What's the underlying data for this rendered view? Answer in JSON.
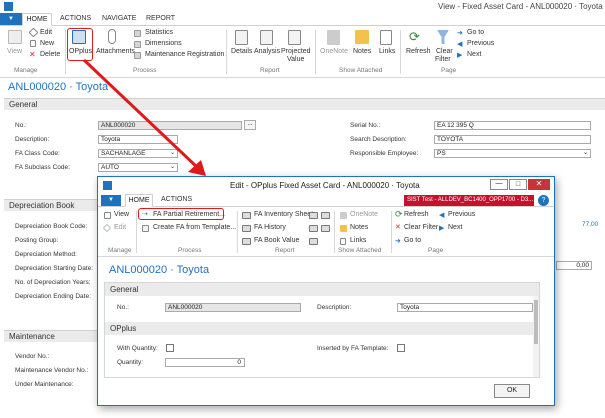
{
  "main": {
    "window_title": "View - Fixed Asset Card - ANL000020 · Toyota",
    "tabs": [
      "HOME",
      "ACTIONS",
      "NAVIGATE",
      "REPORT"
    ],
    "ribbon": {
      "view": "View",
      "edit": "Edit",
      "new": "New",
      "delete": "Delete",
      "oplus": "OPplus",
      "attachments": "Attachments",
      "statistics": "Statistics",
      "dimensions": "Dimensions",
      "maintenance_registration": "Maintenance Registration",
      "details": "Details",
      "analysis": "Analysis",
      "projected_value": [
        "Projected",
        "Value"
      ],
      "onenote": "OneNote",
      "notes": "Notes",
      "links": "Links",
      "refresh": "Refresh",
      "clear_filter": [
        "Clear",
        "Filter"
      ],
      "goto": "Go to",
      "previous": "Previous",
      "next": "Next",
      "groups": [
        "Manage",
        "Process",
        "Report",
        "Show Attached",
        "Page"
      ]
    },
    "heading": "ANL000020 · Toyota",
    "general": {
      "title": "General",
      "no_label": "No.:",
      "no_value": "ANL000020",
      "description_label": "Description:",
      "description_value": "Toyota",
      "class_label": "FA Class Code:",
      "class_value": "SACHANLAGE",
      "subclass_label": "FA Subclass Code:",
      "subclass_value": "AUTO",
      "serial_label": "Serial No.:",
      "serial_value": "EA 12 395 Q",
      "search_label": "Search Description:",
      "search_value": "TOYOTA",
      "employee_label": "Responsible Employee:",
      "employee_value": "PS"
    },
    "depreciation": {
      "title": "Depreciation Book",
      "labels": [
        "Depreciation Book Code:",
        "Posting Group:",
        "Depreciation Method:",
        "Depreciation Starting Date:",
        "No. of Depreciation Years:",
        "Depreciation Ending Date:"
      ],
      "side_value": "77,00",
      "side_zero": "0,00"
    },
    "maintenance": {
      "title": "Maintenance",
      "labels": [
        "Vendor No.:",
        "Maintenance Vendor No.:",
        "Under Maintenance:"
      ]
    }
  },
  "dialog": {
    "title": "Edit - OPplus Fixed Asset Card - ANL000020 · Toyota",
    "env_badge": "SIST Test - ALLDEV_BC1400_OPP1700 - D3...",
    "tabs": [
      "HOME",
      "ACTIONS"
    ],
    "ribbon": {
      "view": "View",
      "edit": "Edit",
      "partial_retirement": "FA Partial Retirement...",
      "create_from_template": "Create FA from Template...",
      "inventory_sheet": "FA Inventory Sheet",
      "history": "FA History",
      "book_value": "FA Book Value",
      "onenote": "OneNote",
      "notes": "Notes",
      "links": "Links",
      "refresh": "Refresh",
      "clear_filter": "Clear Filter",
      "goto": "Go to",
      "previous": "Previous",
      "next": "Next",
      "groups": [
        "Manage",
        "Process",
        "Report",
        "Show Attached",
        "Page"
      ]
    },
    "heading": "ANL000020 · Toyota",
    "general": {
      "title": "General",
      "no_label": "No.:",
      "no_value": "ANL000020",
      "description_label": "Description:",
      "description_value": "Toyota"
    },
    "oplus": {
      "title": "OPplus",
      "with_quantity_label": "With Quantity:",
      "quantity_label": "Quantity:",
      "quantity_value": "0",
      "inserted_label": "Inserted by FA Template:"
    },
    "ok": "OK"
  },
  "colors": {
    "accent": "#1e73be",
    "annotation_red": "#e0191b",
    "env_badge_bg": "#c8102e"
  }
}
